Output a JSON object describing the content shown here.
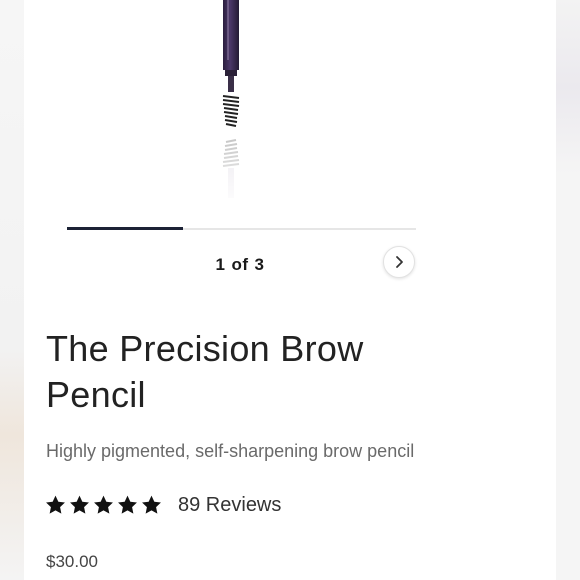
{
  "gallery": {
    "current_page": "1",
    "page_separator": "of",
    "total_pages": "3",
    "progress_fraction": 0.3333,
    "next_icon": "chevron-right-icon",
    "colors": {
      "track": "#e6e6e6",
      "fill": "#1c2235",
      "pencil": "#3b2a52"
    }
  },
  "product": {
    "title": "The Precision Brow Pencil",
    "subtitle": "Highly pigmented, self-sharpening brow pencil",
    "rating": 5,
    "star_icon": "star-icon",
    "reviews": "89 Reviews",
    "price": "$30.00"
  }
}
